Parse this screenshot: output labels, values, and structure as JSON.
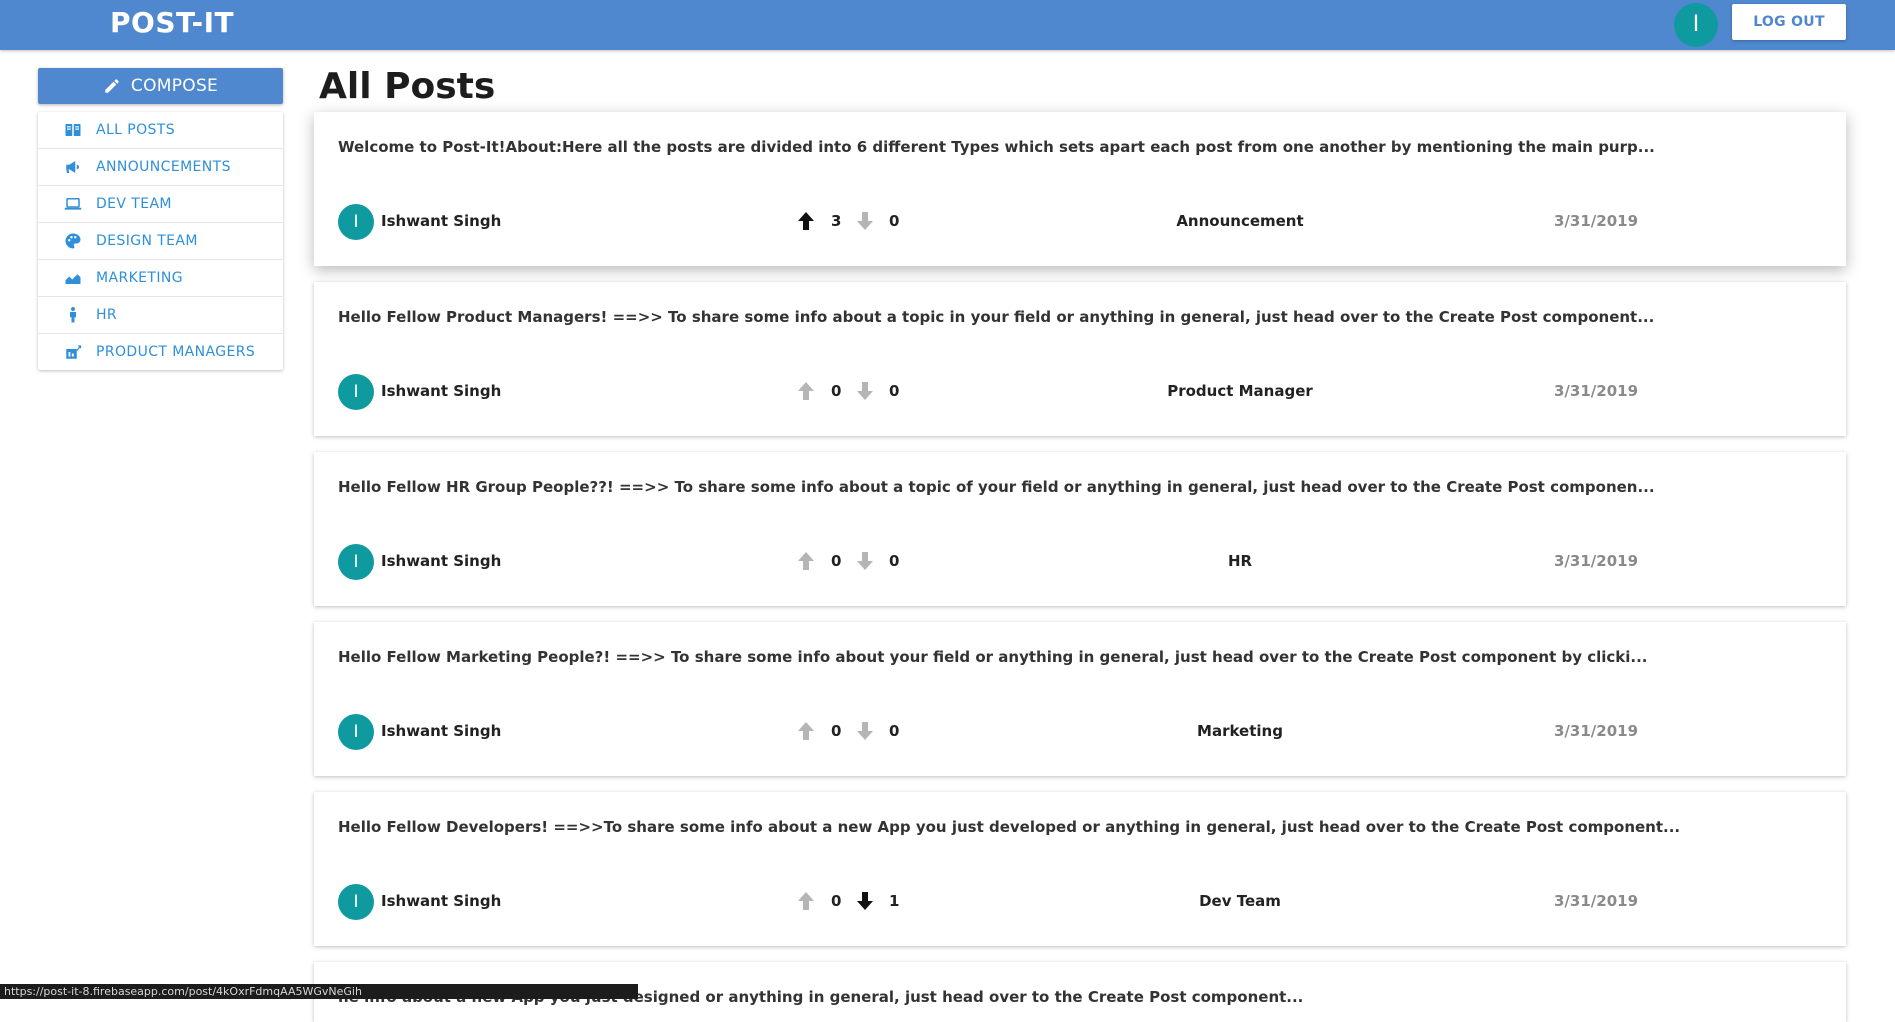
{
  "app": {
    "brand": "POST-IT",
    "user_initial": "I",
    "logout_label": "LOG OUT"
  },
  "sidebar": {
    "compose_label": "COMPOSE",
    "items": [
      {
        "label": "ALL POSTS",
        "icon": "all-posts-icon"
      },
      {
        "label": "ANNOUNCEMENTS",
        "icon": "megaphone-icon"
      },
      {
        "label": "DEV TEAM",
        "icon": "laptop-icon"
      },
      {
        "label": "DESIGN TEAM",
        "icon": "palette-icon"
      },
      {
        "label": "MARKETING",
        "icon": "chart-icon"
      },
      {
        "label": "HR",
        "icon": "person-icon"
      },
      {
        "label": "PRODUCT MANAGERS",
        "icon": "product-icon"
      }
    ]
  },
  "main": {
    "title": "All Posts",
    "posts": [
      {
        "text": "Welcome to Post-It!About:Here all the posts are divided into 6 different Types which sets apart each post from one another by mentioning the main purp...",
        "author_initial": "I",
        "author": "Ishwant Singh",
        "upvotes": "3",
        "downvotes": "0",
        "upvoted": true,
        "downvoted": false,
        "type": "Announcement",
        "date": "3/31/2019"
      },
      {
        "text": "Hello Fellow Product Managers! ==>> To share some info about a topic in your field or anything in general, just head over to the Create Post component...",
        "author_initial": "I",
        "author": "Ishwant Singh",
        "upvotes": "0",
        "downvotes": "0",
        "upvoted": false,
        "downvoted": false,
        "type": "Product Manager",
        "date": "3/31/2019"
      },
      {
        "text": "Hello Fellow HR Group People??! ==>> To share some info about a topic of your field or anything in general, just head over to the Create Post componen...",
        "author_initial": "I",
        "author": "Ishwant Singh",
        "upvotes": "0",
        "downvotes": "0",
        "upvoted": false,
        "downvoted": false,
        "type": "HR",
        "date": "3/31/2019"
      },
      {
        "text": "Hello Fellow Marketing People?! ==>> To share some info about your field or anything in general, just head over to the Create Post component by clicki...",
        "author_initial": "I",
        "author": "Ishwant Singh",
        "upvotes": "0",
        "downvotes": "0",
        "upvoted": false,
        "downvoted": false,
        "type": "Marketing",
        "date": "3/31/2019"
      },
      {
        "text": "Hello Fellow Developers! ==>>To share some info about a new App you just developed or anything in general, just head over to the Create Post component...",
        "author_initial": "I",
        "author": "Ishwant Singh",
        "upvotes": "0",
        "downvotes": "1",
        "upvoted": false,
        "downvoted": true,
        "type": "Dev Team",
        "date": "3/31/2019"
      }
    ],
    "partial_post_text": "ne info about a new App you just designed or anything in general, just head over to the Create Post component..."
  },
  "status_bar": {
    "url": "https://post-it-8.firebaseapp.com/post/4kOxrFdmqAA5WGvNeGih"
  },
  "colors": {
    "appbar": "#4f88cf",
    "avatar": "#0f9aa0",
    "sidebar_text": "#2f8fd8",
    "vote_active": "#111111",
    "vote_inactive": "#b5b5b5",
    "date_text": "#8a8a8a"
  }
}
